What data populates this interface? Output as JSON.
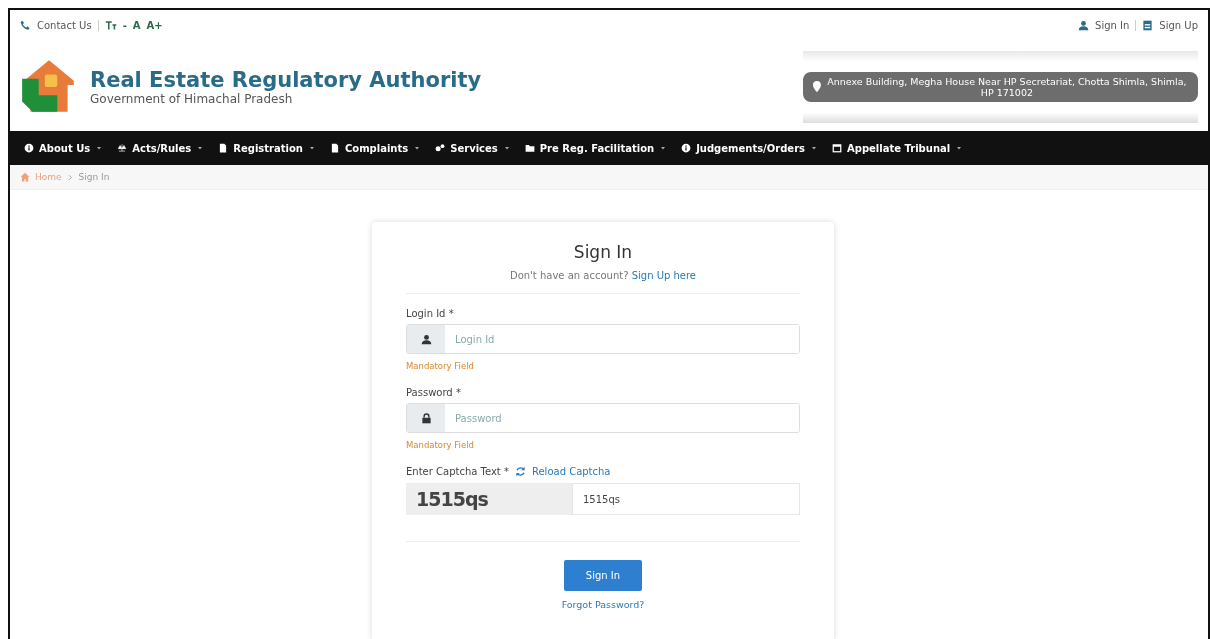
{
  "top_bar": {
    "contact": "Contact Us",
    "font_controls": [
      "-",
      "A",
      "A+"
    ],
    "auth_links": [
      {
        "label": "Sign In",
        "kind": "signin"
      },
      {
        "label": "Sign Up",
        "kind": "signup"
      }
    ]
  },
  "header": {
    "title": "Real Estate Regulatory Authority",
    "subtitle": "Government of Himachal Pradesh",
    "address": "Annexe Building, Megha House Near HP Secretariat, Chotta Shimla, Shimla, HP 171002"
  },
  "nav": {
    "items": [
      {
        "label": "About Us"
      },
      {
        "label": "Acts/Rules"
      },
      {
        "label": "Registration"
      },
      {
        "label": "Complaints"
      },
      {
        "label": "Services"
      },
      {
        "label": "Pre Reg. Facilitation"
      },
      {
        "label": "Judgements/Orders"
      },
      {
        "label": "Appellate Tribunal"
      }
    ]
  },
  "breadcrumb": [
    "Home",
    "Sign In"
  ],
  "signin": {
    "title": "Sign In",
    "prompt": "Don't have an account?",
    "prompt_link": "Sign Up here",
    "fields": [
      {
        "label": "Login Id *",
        "placeholder": "Login Id",
        "hint": "Mandatory Field"
      },
      {
        "label": "Password *",
        "placeholder": "Password",
        "hint": "Mandatory Field"
      }
    ],
    "captcha": {
      "label": "Enter Captcha Text *",
      "reload": "Reload Captcha",
      "image_text": "1515qs",
      "value": "1515qs"
    },
    "button": "Sign In",
    "forgot": "Forgot Password?"
  }
}
